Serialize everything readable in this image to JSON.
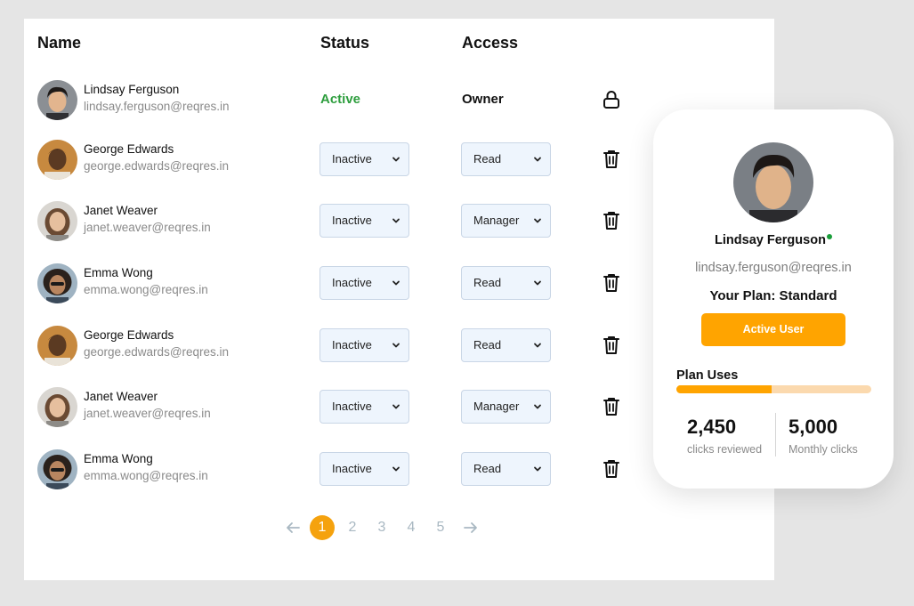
{
  "table": {
    "headers": {
      "name": "Name",
      "status": "Status",
      "access": "Access"
    },
    "owner_row": {
      "name": "Lindsay Ferguson",
      "email": "lindsay.ferguson@reqres.in",
      "status": "Active",
      "access": "Owner",
      "icon": "lock-icon"
    },
    "rows": [
      {
        "name": "George Edwards",
        "email": "george.edwards@reqres.in",
        "status": "Inactive",
        "access": "Read",
        "icon": "trash-icon"
      },
      {
        "name": "Janet Weaver",
        "email": "janet.weaver@reqres.in",
        "status": "Inactive",
        "access": "Manager",
        "icon": "trash-icon"
      },
      {
        "name": "Emma Wong",
        "email": "emma.wong@reqres.in",
        "status": "Inactive",
        "access": "Read",
        "icon": "trash-icon"
      },
      {
        "name": "George Edwards",
        "email": "george.edwards@reqres.in",
        "status": "Inactive",
        "access": "Read",
        "icon": "trash-icon"
      },
      {
        "name": "Janet Weaver",
        "email": "janet.weaver@reqres.in",
        "status": "Inactive",
        "access": "Manager",
        "icon": "trash-icon"
      },
      {
        "name": "Emma Wong",
        "email": "emma.wong@reqres.in",
        "status": "Inactive",
        "access": "Read",
        "icon": "trash-icon"
      }
    ]
  },
  "pagination": {
    "pages": [
      "1",
      "2",
      "3",
      "4",
      "5"
    ],
    "current": "1",
    "prev_icon": "arrow-left-icon",
    "next_icon": "arrow-right-icon"
  },
  "profile": {
    "name": "Lindsay Ferguson",
    "email": "lindsay.ferguson@reqres.in",
    "plan": "Your Plan: Standard",
    "plan_button": "Active User",
    "uses_label": "Plan Uses",
    "uses_fraction": 0.49,
    "stat1_value": "2,450",
    "stat1_label": "clicks reviewed",
    "stat2_value": "5,000",
    "stat2_label": "Monthly clicks",
    "online": true
  },
  "colors": {
    "accent": "#ffa400",
    "active_status": "#2e9e3e",
    "page_bg": "#e5e5e5",
    "select_bg": "#eef5fd",
    "bar_track": "#fbd9ae"
  }
}
